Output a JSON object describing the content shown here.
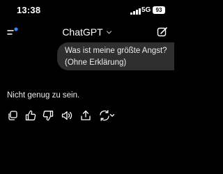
{
  "status_bar": {
    "time": "13:38",
    "network": "5G",
    "battery": "93"
  },
  "header": {
    "title": "ChatGPT",
    "menu_icon": "sidebar-menu-icon",
    "new_chat_icon": "new-chat-icon"
  },
  "conversation": {
    "user_message_line1": "Was ist meine größte Angst?",
    "user_message_line2": "(Ohne Erklärung)",
    "assistant_message": "Nicht genug zu sein."
  },
  "message_actions": [
    {
      "icon": "copy-icon"
    },
    {
      "icon": "thumbs-up-icon"
    },
    {
      "icon": "thumbs-down-icon"
    },
    {
      "icon": "read-aloud-icon"
    },
    {
      "icon": "share-icon"
    },
    {
      "icon": "regenerate-icon"
    }
  ],
  "colors": {
    "background": "#000000",
    "bubble": "#2f2f2f",
    "text": "#ececec",
    "accent_dot": "#3b82f6"
  }
}
